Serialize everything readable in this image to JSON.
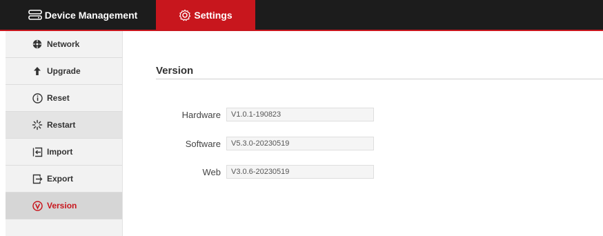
{
  "topnav": {
    "device_tab": {
      "label": "Device Management",
      "icon": "router-icon"
    },
    "settings_tab": {
      "label": "Settings",
      "icon": "gear-icon"
    }
  },
  "sidebar": {
    "items": [
      {
        "label": "Network",
        "icon": "network-icon"
      },
      {
        "label": "Upgrade",
        "icon": "upgrade-arrow-icon"
      },
      {
        "label": "Reset",
        "icon": "info-circle-icon"
      },
      {
        "label": "Restart",
        "icon": "spinner-icon"
      },
      {
        "label": "Import",
        "icon": "import-icon"
      },
      {
        "label": "Export",
        "icon": "export-icon"
      },
      {
        "label": "Version",
        "icon": "version-icon"
      }
    ],
    "active": "Version"
  },
  "main": {
    "title": "Version",
    "fields": [
      {
        "label": "Hardware",
        "value": "V1.0.1-190823"
      },
      {
        "label": "Software",
        "value": "V5.3.0-20230519"
      },
      {
        "label": "Web",
        "value": "V3.0.6-20230519"
      }
    ]
  },
  "colors": {
    "accent": "#c8161d",
    "topbar": "#1c1c1c",
    "sidebar": "#f2f2f2"
  }
}
